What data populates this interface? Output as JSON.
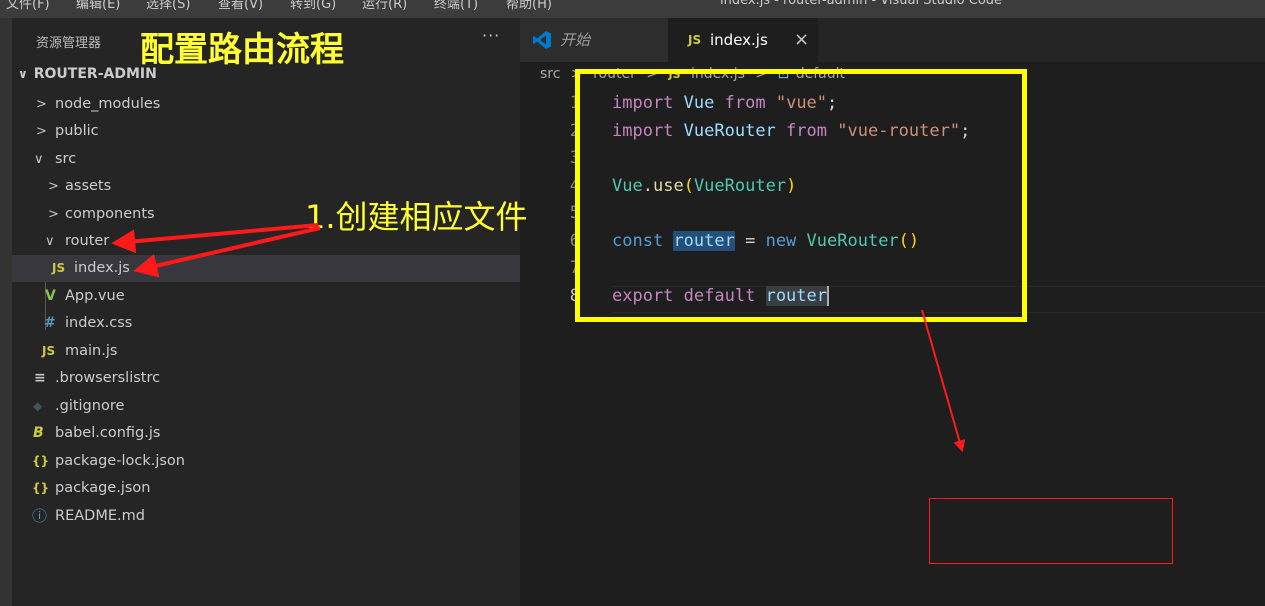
{
  "menu": {
    "items": [
      "文件(F)",
      "编辑(E)",
      "选择(S)",
      "查看(V)",
      "转到(G)",
      "运行(R)",
      "终端(T)",
      "帮助(H)"
    ],
    "window_title": "index.js - router-admin - Visual Studio Code"
  },
  "sidebar": {
    "title": "资源管理器",
    "more_label": "···",
    "project": "ROUTER-ADMIN",
    "items": [
      {
        "label": "node_modules",
        "chevron": ">",
        "icon": ""
      },
      {
        "label": "public",
        "chevron": ">",
        "icon": ""
      },
      {
        "label": "src",
        "chevron": "∨",
        "icon": ""
      },
      {
        "label": "assets",
        "chevron": ">",
        "icon": ""
      },
      {
        "label": "components",
        "chevron": ">",
        "icon": ""
      },
      {
        "label": "router",
        "chevron": "∨",
        "icon": ""
      },
      {
        "label": "index.js",
        "chevron": "",
        "icon": "JS"
      },
      {
        "label": "App.vue",
        "chevron": "",
        "icon": "V"
      },
      {
        "label": "index.css",
        "chevron": "",
        "icon": "#"
      },
      {
        "label": "main.js",
        "chevron": "",
        "icon": "JS"
      },
      {
        "label": ".browserslistrc",
        "chevron": "",
        "icon": "≡"
      },
      {
        "label": ".gitignore",
        "chevron": "",
        "icon": "◆"
      },
      {
        "label": "babel.config.js",
        "chevron": "",
        "icon": "B"
      },
      {
        "label": "package-lock.json",
        "chevron": "",
        "icon": "{}"
      },
      {
        "label": "package.json",
        "chevron": "",
        "icon": "{}"
      },
      {
        "label": "README.md",
        "chevron": "",
        "icon": "ⓘ"
      }
    ]
  },
  "annotations": {
    "title": "配置路由流程",
    "step1": "1.创建相应文件"
  },
  "tabs": [
    {
      "label": "开始",
      "icon": "vscode-icon"
    },
    {
      "label": "index.js",
      "icon": "JS",
      "close": "×"
    }
  ],
  "breadcrumb": [
    "src",
    ">",
    "router",
    ">",
    "JS",
    "index.js",
    ">",
    "⊡",
    "default"
  ],
  "code": {
    "line_numbers": [
      "1",
      "2",
      "3",
      "4",
      "5",
      "6",
      "7",
      "8"
    ],
    "lines": [
      "import Vue from \"vue\";",
      "import VueRouter from \"vue-router\";",
      "",
      "Vue.use(VueRouter)",
      "",
      "const router = new VueRouter()",
      "",
      "export default router"
    ]
  },
  "colors": {
    "annotation_yellow": "#ffff33",
    "highlight_box": "#ffff00",
    "arrow_red": "#ff1a1a"
  }
}
